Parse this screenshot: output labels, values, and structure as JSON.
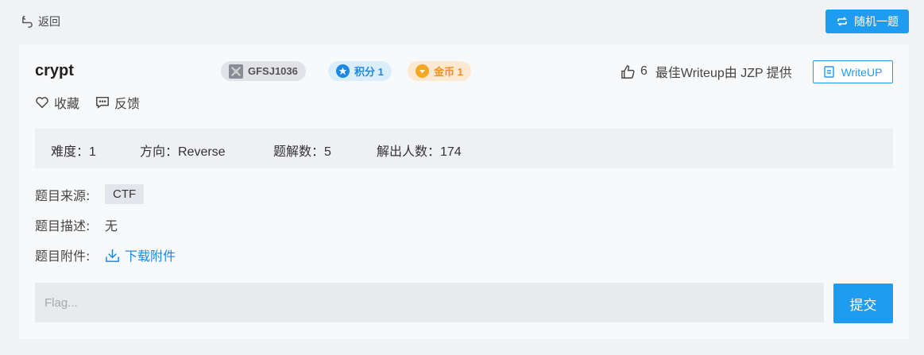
{
  "header": {
    "back_label": "返回",
    "random_label": "随机一题"
  },
  "challenge": {
    "title": "crypt",
    "badges": {
      "id": "GFSJ1036",
      "score": "积分 1",
      "coin": "金币 1"
    },
    "likes": "6",
    "best_writeup": "最佳Writeup由 JZP 提供",
    "writeup_button": "WriteUP"
  },
  "actions": {
    "favorite": "收藏",
    "feedback": "反馈"
  },
  "stats": {
    "difficulty": "难度：1",
    "direction": "方向：Reverse",
    "solves": "题解数：5",
    "solvers": "解出人数：174"
  },
  "details": {
    "source_label": "题目来源:",
    "source_value": "CTF",
    "description_label": "题目描述:",
    "description_value": "无",
    "attachment_label": "题目附件:",
    "attachment_link": "下载附件"
  },
  "flag": {
    "placeholder": "Flag...",
    "submit_label": "提交"
  },
  "colors": {
    "accent": "#1e9cf0",
    "score": "#1e88e5",
    "coin": "#f0901e"
  }
}
